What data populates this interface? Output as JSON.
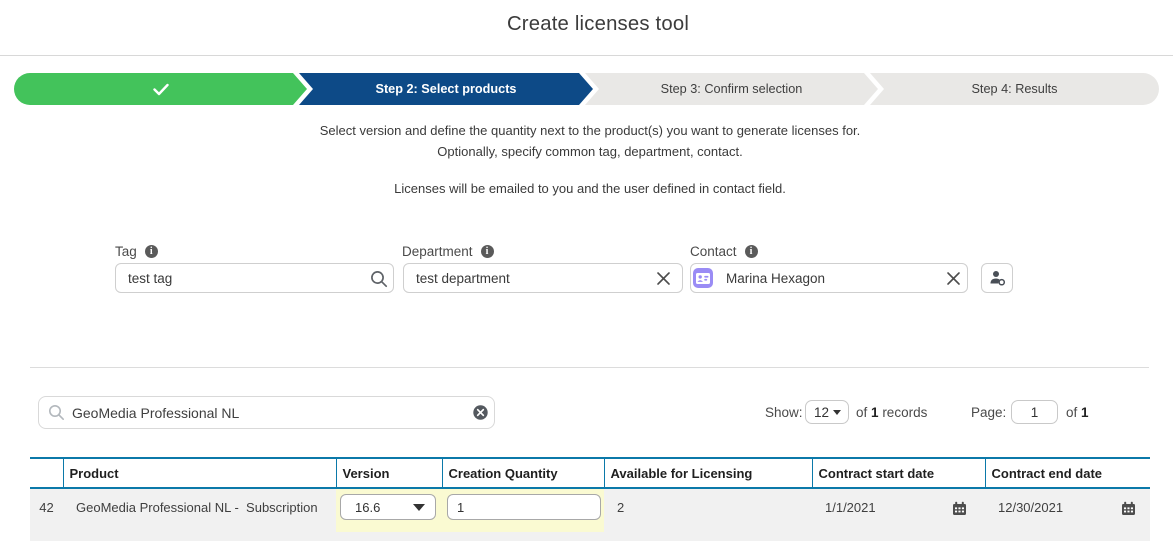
{
  "header": {
    "title": "Create licenses tool"
  },
  "stepper": {
    "steps": [
      {
        "label": "",
        "state": "completed",
        "icon": "checkmark-icon"
      },
      {
        "label": "Step 2: Select products",
        "state": "active"
      },
      {
        "label": "Step 3: Confirm selection",
        "state": "upcoming"
      },
      {
        "label": "Step 4: Results",
        "state": "upcoming"
      }
    ],
    "colors": {
      "completed": "#43c35b",
      "active": "#0d4a87",
      "upcoming": "#e9e8e6"
    }
  },
  "instructions": {
    "line1": "Select version and define the quantity next to the product(s) you want to generate licenses for.",
    "line2": "Optionally, specify common tag, department, contact.",
    "line3": "Licenses will be emailed to you and the user defined in contact field."
  },
  "filters": {
    "tag": {
      "label": "Tag",
      "value": "test tag",
      "icon": "search-icon"
    },
    "department": {
      "label": "Department",
      "value": "test department",
      "icon": "clear-x-icon"
    },
    "contact": {
      "label": "Contact",
      "value": "Marina Hexagon",
      "icon_left": "contact-card-icon",
      "icon_right": "clear-x-icon"
    },
    "assign_user_button": {
      "icon": "user-settings-icon"
    },
    "info_icon_glyph": "i"
  },
  "toolbar": {
    "search": {
      "value": "GeoMedia Professional NL",
      "icon": "search-icon",
      "clear_icon": "circle-clear-icon"
    },
    "show": {
      "label": "Show:",
      "page_size": "12",
      "of": "of",
      "count": "1",
      "records": "records"
    },
    "page": {
      "label": "Page:",
      "value": "1",
      "of": "of",
      "total": "1"
    }
  },
  "table": {
    "headers": [
      "",
      "Product",
      "Version",
      "Creation Quantity",
      "Available for Licensing",
      "Contract start date",
      "Contract end date"
    ],
    "rows": [
      {
        "row_number": "42",
        "product": "GeoMedia Professional NL -  Subscription",
        "version": "16.6",
        "creation_quantity": "1",
        "available_for_licensing": "2",
        "contract_start_date": "1/1/2021",
        "contract_end_date": "12/30/2021"
      }
    ],
    "border_color": "#0b79a9",
    "highlight_color": "#fafad2"
  }
}
